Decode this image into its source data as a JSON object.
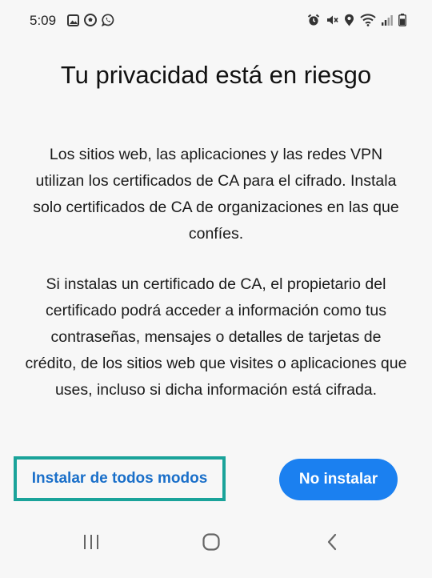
{
  "status_bar": {
    "time": "5:09",
    "left_icons": [
      "gallery-icon",
      "soccer-ball-icon",
      "whatsapp-icon"
    ],
    "right_icons": [
      "alarm-icon",
      "mute-icon",
      "location-icon",
      "wifi-icon",
      "signal-icon",
      "battery-icon"
    ]
  },
  "dialog": {
    "title": "Tu privacidad está en riesgo",
    "paragraph_1": "Los sitios web, las aplicaciones y las redes VPN utilizan los certificados de CA para el cifrado. Instala solo certificados de CA de organizaciones en las que confíes.",
    "paragraph_2": "Si instalas un certificado de CA, el propietario del certificado podrá acceder a información como tus contraseñas, mensajes o detalles de tarjetas de crédito, de los sitios web que visites o aplicaciones que uses, incluso si dicha información está cifrada.",
    "install_anyway_label": "Instalar de todos modos",
    "no_install_label": "No instalar"
  },
  "colors": {
    "background": "#f7f7f7",
    "accent_blue": "#1b80f0",
    "link_blue": "#1a6fc9",
    "highlight_teal": "#1aa39a"
  },
  "nav_bar": {
    "buttons": [
      "recents-icon",
      "home-icon",
      "back-icon"
    ]
  }
}
